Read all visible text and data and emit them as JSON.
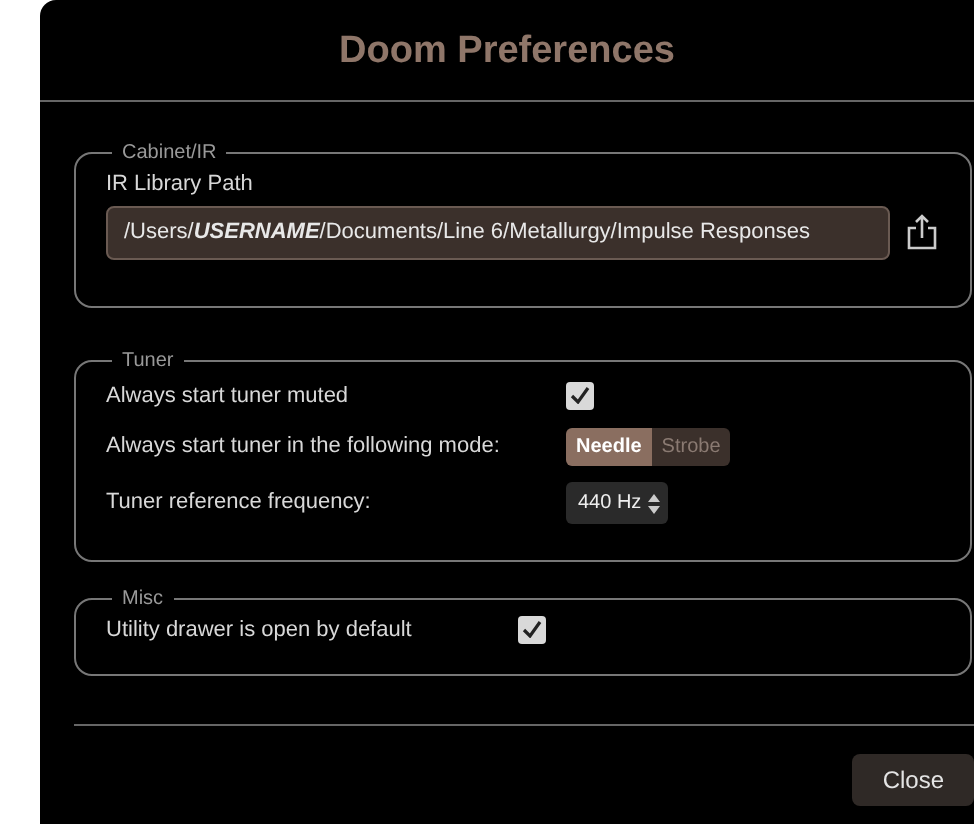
{
  "window": {
    "title": "Doom Preferences"
  },
  "cabinet": {
    "legend": "Cabinet/IR",
    "path_label": "IR Library Path",
    "path_value": "/Users/**USERNAME**/Documents/Line 6/Metallurgy/Impulse Responses"
  },
  "tuner": {
    "legend": "Tuner",
    "rows": [
      {
        "kind": "checkbox",
        "label": "Always start tuner muted",
        "checked": true
      },
      {
        "kind": "segmented",
        "label": "Always start tuner in the following mode:",
        "options": [
          {
            "label": "Needle",
            "selected": true
          },
          {
            "label": "Strobe",
            "selected": false
          }
        ]
      },
      {
        "kind": "stepper",
        "label": "Tuner reference frequency:",
        "value": "440 Hz"
      }
    ]
  },
  "misc": {
    "legend": "Misc",
    "rows": [
      {
        "kind": "checkbox",
        "label": "Utility drawer is open by default",
        "checked": true
      }
    ]
  },
  "buttons": [
    {
      "label": "Close"
    }
  ]
}
